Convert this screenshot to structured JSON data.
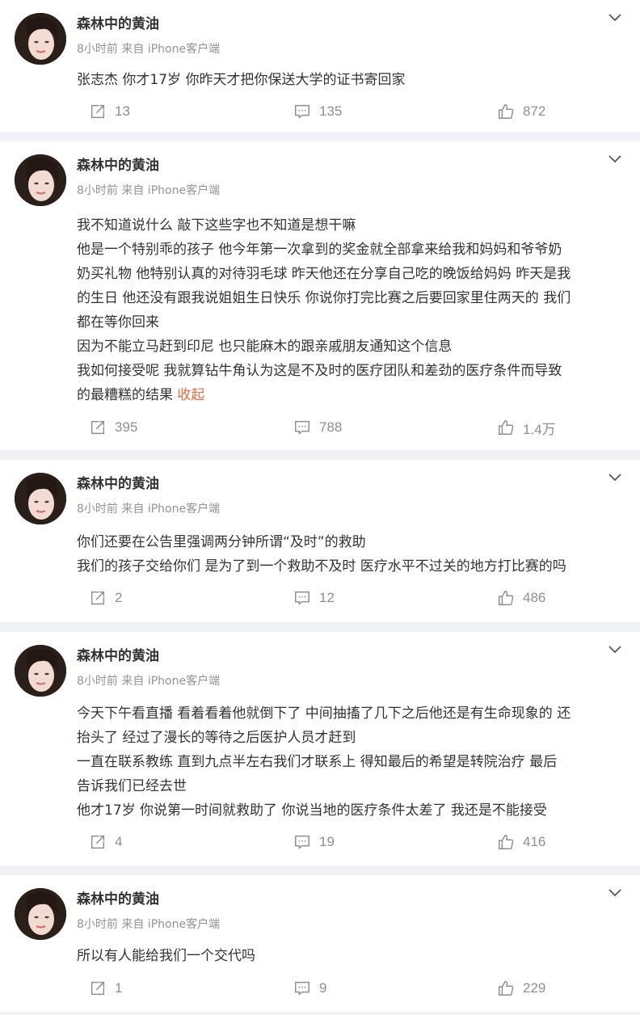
{
  "posts": [
    {
      "username": "森林中的黄油",
      "meta": "8小时前 来自 iPhone客户端",
      "lines": [
        "张志杰 你才17岁 你昨天才把你保送大学的证书寄回家"
      ],
      "collapse": "",
      "repost": "13",
      "comment": "135",
      "like": "872"
    },
    {
      "username": "森林中的黄油",
      "meta": "8小时前 来自 iPhone客户端",
      "lines": [
        "我不知道说什么 敲下这些字也不知道是想干嘛",
        "他是一个特别乖的孩子 他今年第一次拿到的奖金就全部拿来给我和妈妈和爷爷奶",
        "奶买礼物 他特别认真的对待羽毛球 昨天他还在分享自己吃的晚饭给妈妈 昨天是我",
        "的生日 他还没有跟我说姐姐生日快乐 你说你打完比赛之后要回家里住两天的 我们",
        "都在等你回来",
        "因为不能立马赶到印尼 也只能麻木的跟亲戚朋友通知这个信息",
        "我如何接受呢 我就算钻牛角认为这是不及时的医疗团队和差劲的医疗条件而导致",
        "的最糟糕的结果 "
      ],
      "collapse": "收起",
      "repost": "395",
      "comment": "788",
      "like": "1.4万"
    },
    {
      "username": "森林中的黄油",
      "meta": "8小时前 来自 iPhone客户端",
      "lines": [
        "你们还要在公告里强调两分钟所谓“及时”的救助",
        "我们的孩子交给你们 是为了到一个救助不及时 医疗水平不过关的地方打比赛的吗"
      ],
      "collapse": "",
      "repost": "2",
      "comment": "12",
      "like": "486"
    },
    {
      "username": "森林中的黄油",
      "meta": "8小时前 来自 iPhone客户端",
      "lines": [
        "今天下午看直播 看着看着他就倒下了 中间抽搐了几下之后他还是有生命现象的 还",
        "抬头了 经过了漫长的等待之后医护人员才赶到",
        "一直在联系教练 直到九点半左右我们才联系上 得知最后的希望是转院治疗  最后",
        "告诉我们已经去世",
        "他才17岁 你说第一时间就救助了 你说当地的医疗条件太差了 我还是不能接受"
      ],
      "collapse": "",
      "repost": "4",
      "comment": "19",
      "like": "416"
    },
    {
      "username": "森林中的黄油",
      "meta": "8小时前 来自 iPhone客户端",
      "lines": [
        "所以有人能给我们一个交代吗"
      ],
      "collapse": "",
      "repost": "1",
      "comment": "9",
      "like": "229"
    }
  ]
}
